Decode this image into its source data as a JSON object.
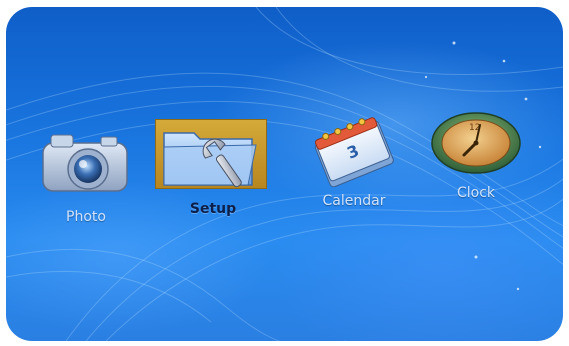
{
  "menu": {
    "items": [
      {
        "label": "Photo",
        "icon": "camera-icon",
        "selected": false
      },
      {
        "label": "Setup",
        "icon": "folder-wrench-icon",
        "selected": true
      },
      {
        "label": "Calendar",
        "icon": "calendar-icon",
        "selected": false
      },
      {
        "label": "Clock",
        "icon": "clock-icon",
        "selected": false
      }
    ],
    "calendar_day": "3",
    "clock_number": "12"
  },
  "colors": {
    "background": "#1a76e0",
    "selection": "#c99a2c",
    "label": "#cfe3ff",
    "selected_label": "#0b1f4a"
  }
}
